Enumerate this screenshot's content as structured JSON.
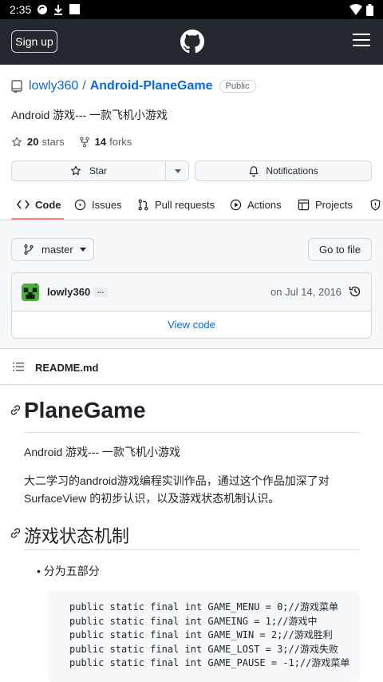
{
  "status_bar": {
    "time": "2:35"
  },
  "header": {
    "signup_label": "Sign up"
  },
  "repo": {
    "owner": "lowly360",
    "separator": "/",
    "name": "Android-PlaneGame",
    "visibility": "Public",
    "description": "Android 游戏--- 一款飞机小游戏",
    "stars_count": "20",
    "stars_label": "stars",
    "forks_count": "14",
    "forks_label": "forks",
    "star_button": "Star",
    "notifications_button": "Notifications"
  },
  "tabs": [
    {
      "label": "Code",
      "icon": "code-icon"
    },
    {
      "label": "Issues",
      "icon": "issue-icon"
    },
    {
      "label": "Pull requests",
      "icon": "pull-request-icon"
    },
    {
      "label": "Actions",
      "icon": "play-icon"
    },
    {
      "label": "Projects",
      "icon": "table-icon"
    }
  ],
  "branch": {
    "name": "master",
    "goto_file": "Go to file"
  },
  "commit": {
    "author": "lowly360",
    "ellipsis": "…",
    "date": "on Jul 14, 2016",
    "view_code": "View code"
  },
  "readme": {
    "filename": "README.md",
    "h1": "PlaneGame",
    "intro": "Android 游戏--- 一款飞机小游戏",
    "paragraph": "大二学习的android游戏编程实训作品，通过这个作品加深了对 SurfaceView 的初步认识，以及游戏状态机制认识。",
    "h2": "游戏状态机制",
    "bullet": "分为五部分",
    "code_lines": [
      "public static final int GAME_MENU = 0;//游戏菜单",
      "public static final int GAMEING = 1;//游戏中",
      "public static final int GAME_WIN = 2;//游戏胜利",
      "public static final int GAME_LOST = 3;//游戏失败",
      "public static final int GAME_PAUSE = -1;//游戏菜单"
    ]
  },
  "colors": {
    "header_bg": "#24292f",
    "link": "#0969da",
    "tab_underline": "#fd8c73"
  }
}
